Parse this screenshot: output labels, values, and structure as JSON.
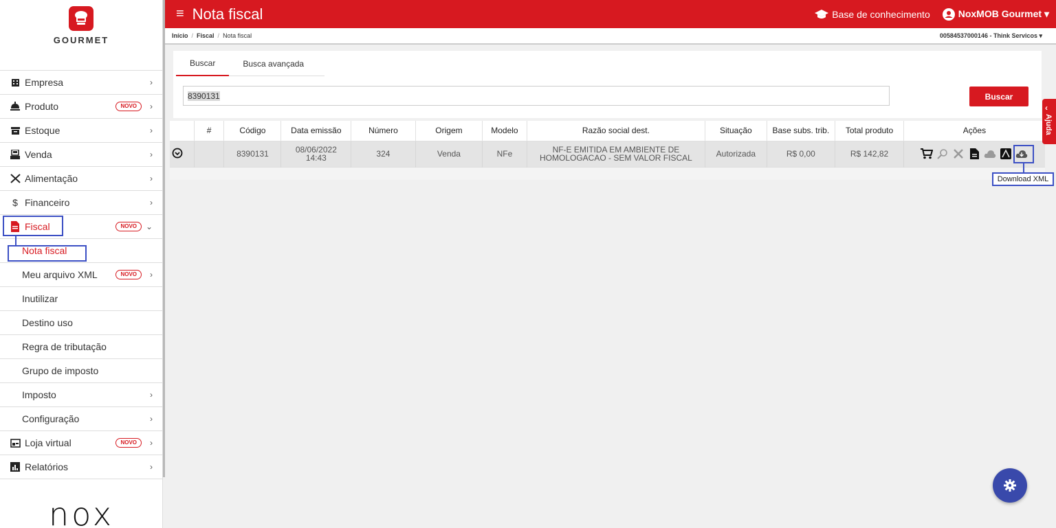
{
  "brand": {
    "name": "GOURMET",
    "footer_logo": "nox"
  },
  "header": {
    "title": "Nota fiscal",
    "knowledge_link": "Base de conhecimento",
    "user_menu": "NoxMOB Gourmet ▾"
  },
  "breadcrumb": {
    "items": [
      "Início",
      "Fiscal",
      "Nota fiscal"
    ],
    "company": "00584537000146 - Think Servicos ▾"
  },
  "sidebar": {
    "novo_badge": "NOVO",
    "items": [
      {
        "label": "Empresa"
      },
      {
        "label": "Produto"
      },
      {
        "label": "Estoque"
      },
      {
        "label": "Venda"
      },
      {
        "label": "Alimentação"
      },
      {
        "label": "Financeiro"
      },
      {
        "label": "Fiscal"
      },
      {
        "label": "Nota fiscal"
      },
      {
        "label": "Meu arquivo XML"
      },
      {
        "label": "Inutilizar"
      },
      {
        "label": "Destino uso"
      },
      {
        "label": "Regra de tributação"
      },
      {
        "label": "Grupo de imposto"
      },
      {
        "label": "Imposto"
      },
      {
        "label": "Configuração"
      },
      {
        "label": "Loja virtual"
      },
      {
        "label": "Relatórios"
      }
    ]
  },
  "search": {
    "tabs": [
      "Buscar",
      "Busca avançada"
    ],
    "value": "8390131",
    "button": "Buscar"
  },
  "table": {
    "columns": [
      "#",
      "Código",
      "Data emissão",
      "Número",
      "Origem",
      "Modelo",
      "Razão social dest.",
      "Situação",
      "Base subs. trib.",
      "Total produto",
      "Ações"
    ],
    "rows": [
      {
        "codigo": "8390131",
        "data_1": "08/06/2022",
        "data_2": "14:43",
        "numero": "324",
        "origem": "Venda",
        "modelo": "NFe",
        "razao_1": "NF-E EMITIDA EM AMBIENTE DE",
        "razao_2": "HOMOLOGACAO - SEM VALOR FISCAL",
        "situacao": "Autorizada",
        "base": "R$ 0,00",
        "total": "R$ 142,82"
      }
    ]
  },
  "tooltip": "Download XML",
  "help_tab": "Ajuda",
  "colors": {
    "primary": "#d71920",
    "highlight": "#3b4fc4",
    "fab": "#3949ab"
  }
}
